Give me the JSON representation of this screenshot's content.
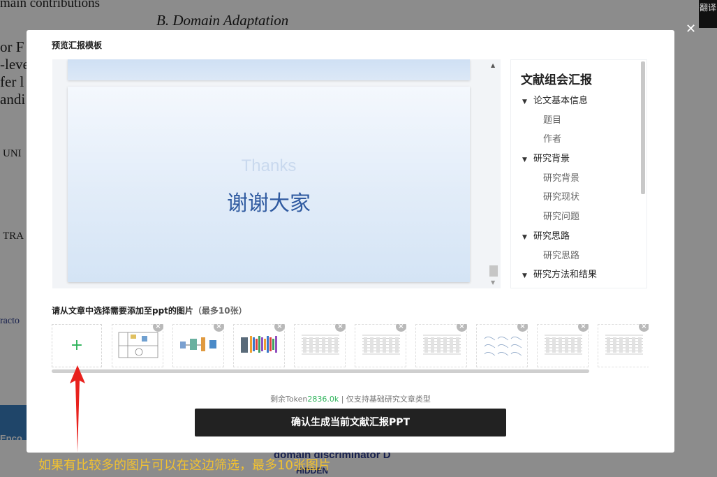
{
  "background": {
    "lines": [
      "main contributions",
      "B. Domain Adaptation",
      "or F",
      "-leve",
      "fer l",
      "andi",
      "UNI",
      "TRA",
      "racto",
      "Enco",
      "domain discriminator D",
      "HIDDEN"
    ]
  },
  "translate_button": "翻译",
  "modal": {
    "title": "预览汇报模板",
    "slide": {
      "eng_text": "Thanks",
      "cn_text": "谢谢大家"
    },
    "outline": {
      "title": "文献组会汇报",
      "items": [
        {
          "label": "论文基本信息",
          "level": 1
        },
        {
          "label": "题目",
          "level": 2
        },
        {
          "label": "作者",
          "level": 2
        },
        {
          "label": "研究背景",
          "level": 1
        },
        {
          "label": "研究背景",
          "level": 2
        },
        {
          "label": "研究现状",
          "level": 2
        },
        {
          "label": "研究问题",
          "level": 2
        },
        {
          "label": "研究思路",
          "level": 1
        },
        {
          "label": "研究思路",
          "level": 2
        },
        {
          "label": "研究方法和结果",
          "level": 1
        }
      ]
    },
    "images_label": "请从文章中选择需要添加至ppt的图片",
    "images_note": "（最多10张）",
    "add_symbol": "+",
    "remove_symbol": "×",
    "thumbnails": [
      "figure-diagram-icon",
      "figure-pipeline-icon",
      "figure-network-icon",
      "table-icon",
      "table-icon",
      "table-icon",
      "plot-grid-icon",
      "table-icon",
      "table-icon"
    ],
    "token_prefix": "剩余Token",
    "token_value": "2836.0k",
    "token_suffix": "| 仅支持基础研究文章类型",
    "confirm_label": "确认生成当前文献汇报PPT"
  },
  "annotation": "如果有比较多的图片可以在这边筛选，最多10张图片",
  "colors": {
    "accent_green": "#2eb35a",
    "button_dark": "#222222",
    "annotation_yellow": "#f2c230",
    "arrow_red": "#e8211d"
  }
}
